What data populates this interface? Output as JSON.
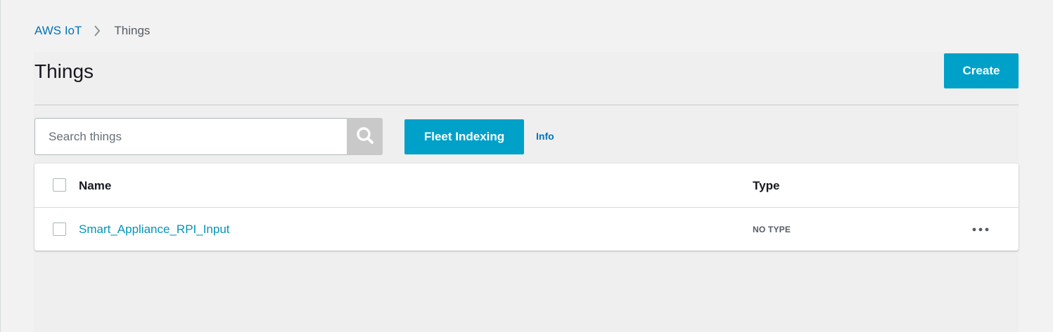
{
  "breadcrumb": {
    "root_label": "AWS IoT",
    "current_label": "Things"
  },
  "page": {
    "title": "Things",
    "create_label": "Create"
  },
  "search": {
    "placeholder": "Search things",
    "value": ""
  },
  "toolbar": {
    "fleet_indexing_label": "Fleet Indexing",
    "info_label": "Info"
  },
  "table": {
    "columns": [
      "Name",
      "Type"
    ],
    "rows": [
      {
        "name": "Smart_Appliance_RPI_Input",
        "type": "NO TYPE"
      }
    ]
  },
  "colors": {
    "accent": "#00a1c9",
    "link": "#0073bb",
    "background": "#f2f2f2"
  },
  "icons": {
    "breadcrumb_separator": "chevron-right-icon",
    "search": "search-icon",
    "row_actions": "more-horizontal-icon"
  }
}
